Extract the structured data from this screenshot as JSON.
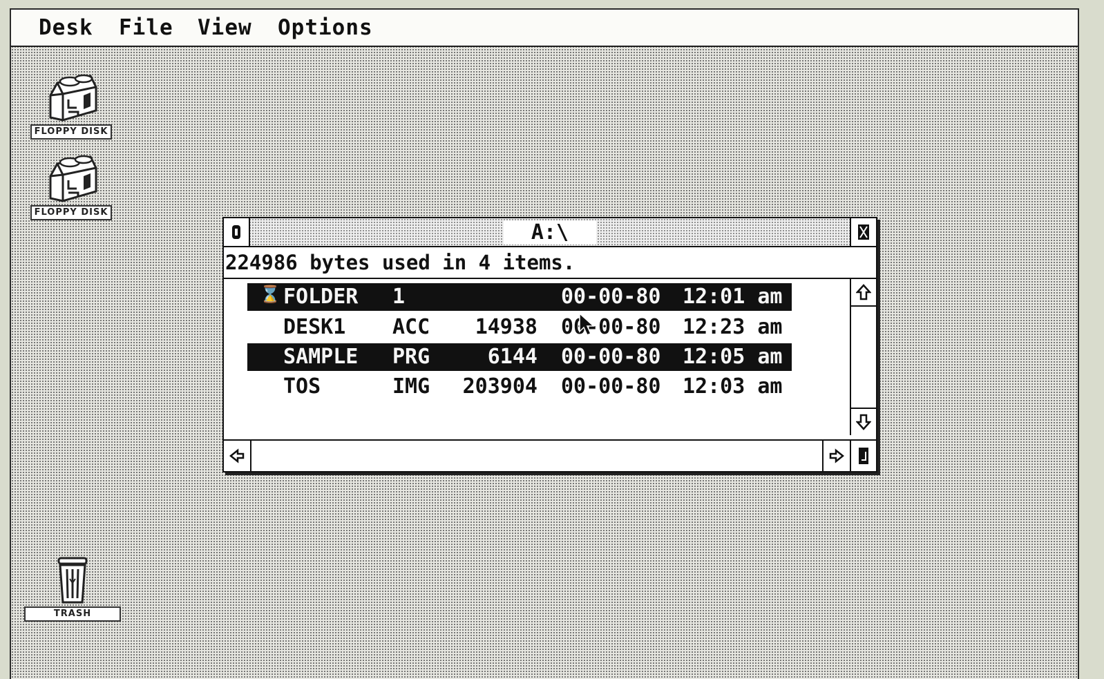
{
  "menubar": {
    "items": [
      "Desk",
      "File",
      "View",
      "Options"
    ]
  },
  "desktop": {
    "icons": [
      {
        "label": "FLOPPY DISK",
        "icon": "floppy-drive-icon",
        "drive": "A"
      },
      {
        "label": "FLOPPY DISK",
        "icon": "floppy-drive-icon",
        "drive": "B"
      },
      {
        "label": "TRASH",
        "icon": "trash-can-icon"
      }
    ]
  },
  "window": {
    "title": "A:\\",
    "info": "224986 bytes used in 4 items.",
    "files": [
      {
        "icon": "folder-icon",
        "name": "FOLDER",
        "ext": "1",
        "size": "",
        "date": "00-00-80",
        "time": "12:01 am",
        "selected": true
      },
      {
        "icon": "",
        "name": "DESK1",
        "ext": "ACC",
        "size": "14938",
        "date": "00-00-80",
        "time": "12:23 am",
        "selected": false
      },
      {
        "icon": "",
        "name": "SAMPLE",
        "ext": "PRG",
        "size": "6144",
        "date": "00-00-80",
        "time": "12:05 am",
        "selected": true
      },
      {
        "icon": "",
        "name": "TOS",
        "ext": "IMG",
        "size": "203904",
        "date": "00-00-80",
        "time": "12:03 am",
        "selected": false
      }
    ]
  },
  "colors": {
    "desktop_pattern": "#5a5a5a",
    "selection": "#111111",
    "window_bg": "#ffffff"
  }
}
